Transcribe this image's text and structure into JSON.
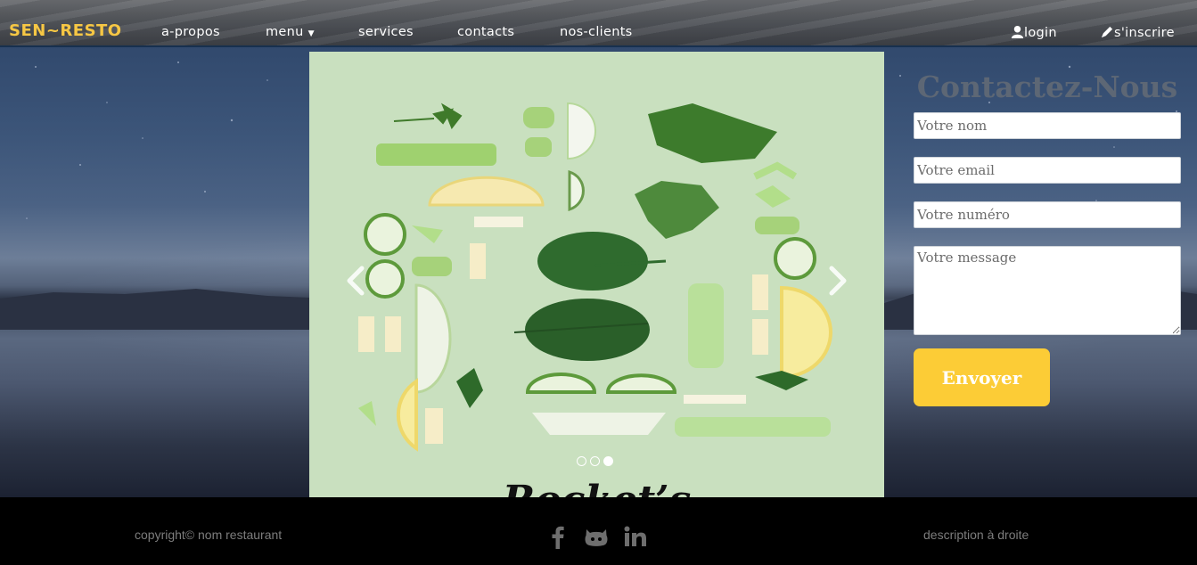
{
  "navbar": {
    "brand": "SEN~RESTO",
    "links": [
      {
        "label": "a-propos"
      },
      {
        "label": "menu"
      },
      {
        "label": "services"
      },
      {
        "label": "contacts"
      },
      {
        "label": "nos-clients"
      }
    ],
    "login_label": "login",
    "signup_label": "s'inscrire"
  },
  "carousel": {
    "caption": "Rocket’s",
    "slide_count": 3,
    "active_slide": 3
  },
  "contact": {
    "title": "Contactez-Nous",
    "name_placeholder": "Votre nom",
    "email_placeholder": "Votre email",
    "phone_placeholder": "Votre numéro",
    "message_placeholder": "Votre message",
    "submit_label": "Envoyer"
  },
  "footer": {
    "copyright": "copyright© nom restaurant",
    "description": "description à droite",
    "social_icons": [
      "facebook-icon",
      "github-icon",
      "linkedin-icon"
    ]
  },
  "colors": {
    "brand": "#f7c744",
    "button": "#fccc36",
    "footer_bg": "#000000",
    "carousel_bg": "#c9e0bf"
  }
}
